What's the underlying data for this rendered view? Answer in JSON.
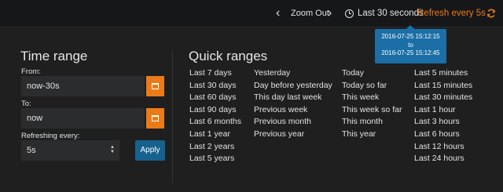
{
  "nav": {
    "prev_icon": "chevron-left-icon",
    "zoom_out_label": "Zoom Out",
    "next_icon": "chevron-right-icon",
    "time_range_label": "Last 30 seconds",
    "refresh_label": "Refresh every 5s",
    "refresh_icon": "refresh-icon",
    "accent_color": "#eb7b18"
  },
  "tooltip": {
    "from": "2016-07-25 15:12:15",
    "to_word": "to",
    "to": "2016-07-25 15:12:45"
  },
  "time_range": {
    "title": "Time range",
    "from_label": "From:",
    "from_value": "now-30s",
    "to_label": "To:",
    "to_value": "now",
    "refresh_label": "Refreshing every:",
    "refresh_value": "5s",
    "apply_label": "Apply"
  },
  "quick_ranges": {
    "title": "Quick ranges",
    "columns": [
      [
        "Last 7 days",
        "Last 30 days",
        "Last 60 days",
        "Last 90 days",
        "Last 6 months",
        "Last 1 year",
        "Last 2 years",
        "Last 5 years"
      ],
      [
        "Yesterday",
        "Day before yesterday",
        "This day last week",
        "Previous week",
        "Previous month",
        "Previous year"
      ],
      [
        "Today",
        "Today so far",
        "This week",
        "This week so far",
        "This month",
        "This year"
      ],
      [
        "Last 5 minutes",
        "Last 15 minutes",
        "Last 30 minutes",
        "Last 1 hour",
        "Last 3 hours",
        "Last 6 hours",
        "Last 12 hours",
        "Last 24 hours"
      ]
    ]
  }
}
